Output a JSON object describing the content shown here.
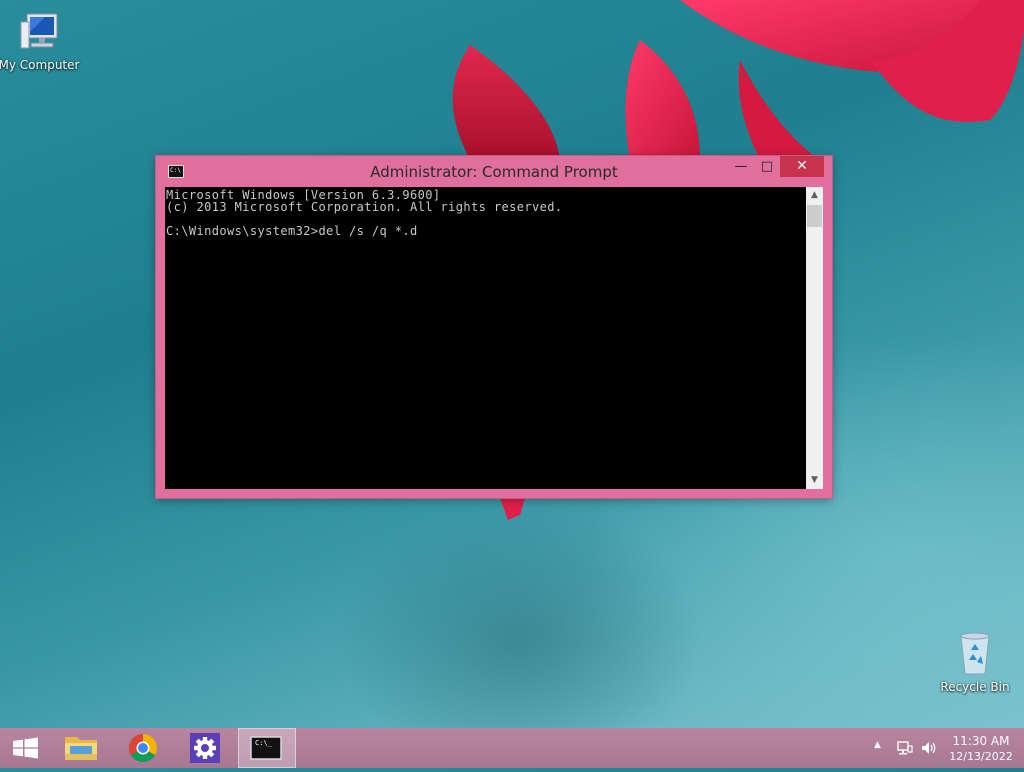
{
  "desktop": {
    "icons": [
      {
        "label": "My Computer",
        "icon": "computer-icon"
      },
      {
        "label": "Recycle Bin",
        "icon": "recycle-bin-icon"
      }
    ]
  },
  "cmd": {
    "title": "Administrator: Command Prompt",
    "title_icon_text": "C:\\",
    "controls": {
      "minimize": "—",
      "maximize": "□",
      "close": "✕"
    },
    "output": "Microsoft Windows [Version 6.3.9600]\n(c) 2013 Microsoft Corporation. All rights reserved.\n\nC:\\Windows\\system32>del /s /q *.d",
    "scroll_up": "▲",
    "scroll_down": "▼"
  },
  "taskbar": {
    "start_icon": "windows-logo-icon",
    "apps": [
      {
        "name": "File Explorer",
        "icon": "folder-icon",
        "active": false
      },
      {
        "name": "Google Chrome",
        "icon": "chrome-icon",
        "active": false
      },
      {
        "name": "Settings",
        "icon": "gear-icon",
        "active": false
      },
      {
        "name": "Command Prompt",
        "icon": "cmd-icon",
        "active": true
      }
    ],
    "cmd_icon_text": "C:\\_",
    "tray": {
      "show_hidden": "▲"
    },
    "clock": {
      "time": "11:30 AM",
      "date": "12/13/2022"
    }
  },
  "colors": {
    "window_frame": "#e0709b",
    "close_button": "#c7324c",
    "taskbar": "#b7859f"
  }
}
